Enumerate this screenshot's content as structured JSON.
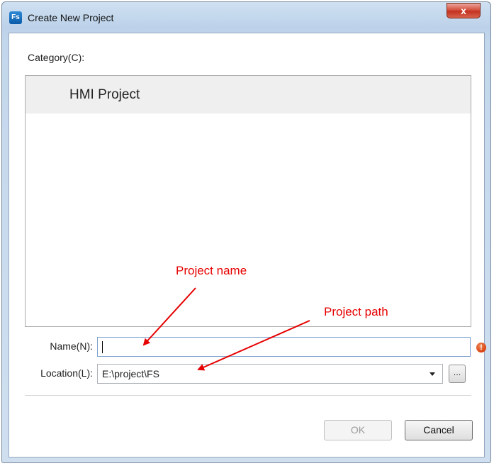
{
  "window": {
    "icon_text": "Fs",
    "title": "Create New Project",
    "close_glyph": "x"
  },
  "category": {
    "label": "Category(C):",
    "items": [
      {
        "label": "HMI Project",
        "selected": true
      }
    ]
  },
  "form": {
    "name_label": "Name(N):",
    "name_value": "",
    "location_label": "Location(L):",
    "location_value": "E:\\project\\FS",
    "browse_label": "...",
    "error_glyph": "!"
  },
  "buttons": {
    "ok_label": "OK",
    "ok_enabled": false,
    "cancel_label": "Cancel"
  },
  "annotations": {
    "project_name": "Project name",
    "project_path": "Project path",
    "color": "#e60000"
  },
  "icons": [
    "app-icon",
    "close-icon",
    "error-icon",
    "chevron-down-icon"
  ]
}
